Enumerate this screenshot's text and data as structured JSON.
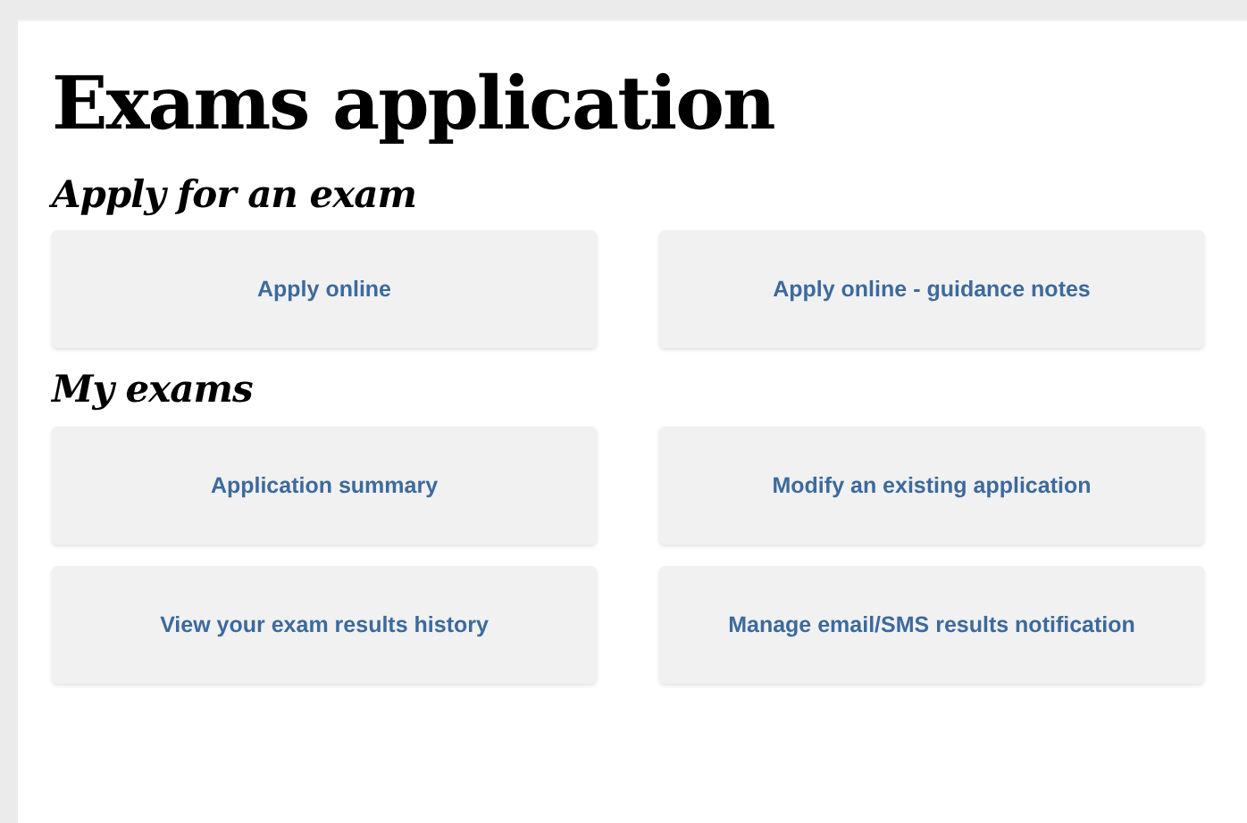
{
  "page": {
    "title": "Exams application"
  },
  "sections": [
    {
      "heading": "Apply for an exam",
      "links": [
        "Apply online",
        "Apply online - guidance notes"
      ]
    },
    {
      "heading": "My exams",
      "links": [
        "Application summary",
        "Modify an existing application",
        "View your exam results history",
        "Manage email/SMS results notification"
      ]
    }
  ]
}
